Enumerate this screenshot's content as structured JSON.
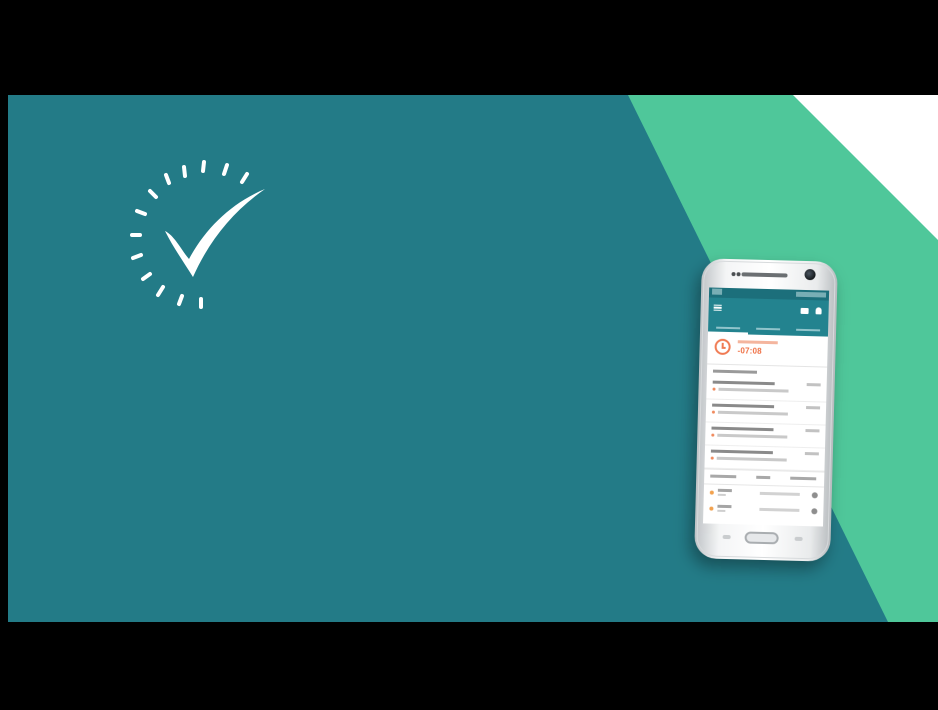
{
  "scene": {
    "colors": {
      "letterbox": "#000000",
      "teal_background": "#237b87",
      "mint_shape": "#4fc79a",
      "white_shape": "#ffffff",
      "icon_color": "#ffffff",
      "accent_orange": "#ef6f43"
    },
    "icon": "clock-checkmark-icon"
  },
  "phone": {
    "screen": {
      "timer_value": "-07:08"
    }
  }
}
